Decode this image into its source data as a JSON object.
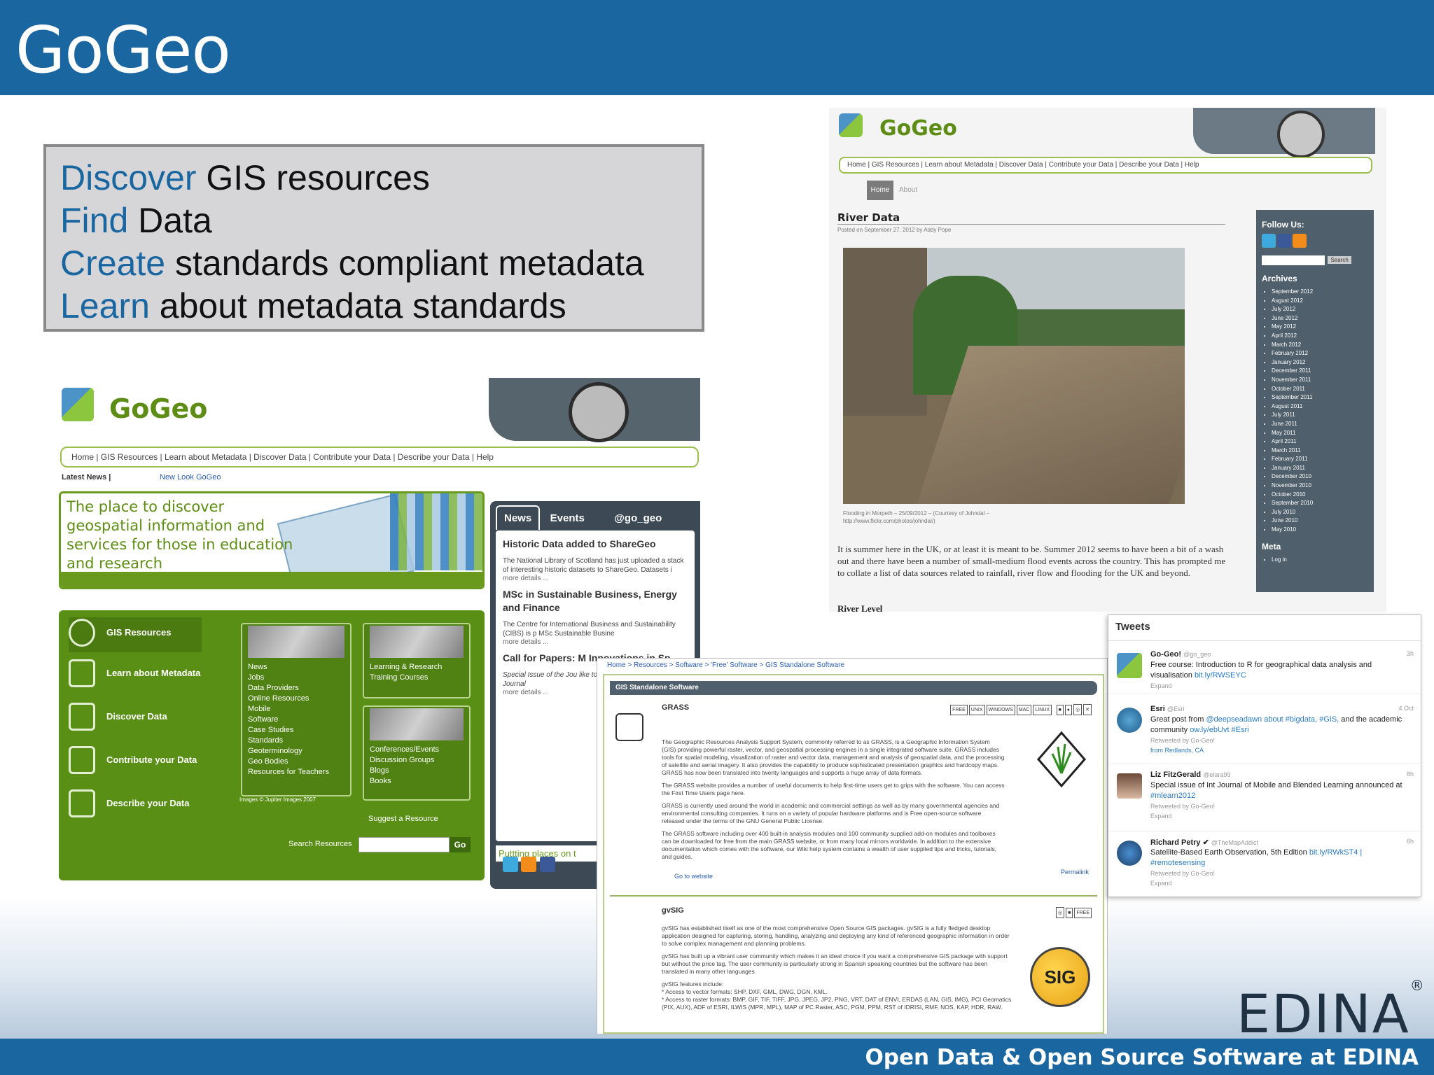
{
  "slide": {
    "title": "GoGeo",
    "footer": "Open Data & Open Source Software at EDINA",
    "logo": "EDINA"
  },
  "callout": [
    {
      "keyword": "Discover",
      "rest": " GIS resources"
    },
    {
      "keyword": "Find",
      "rest": " Data"
    },
    {
      "keyword": "Create",
      "rest": " standards compliant metadata"
    },
    {
      "keyword": "Learn",
      "rest": " about metadata standards"
    }
  ],
  "colors": {
    "brand_blue": "#1a66a0",
    "gogeo_green": "#5a8f16",
    "sidebar_grey": "#4f5f6b",
    "accent_orange": "#e56b1f"
  },
  "blog": {
    "logo": "GoGeo",
    "nav": "Home | GIS Resources | Learn about Metadata | Discover Data | Contribute your Data | Describe your Data | Help",
    "tab_home": "Home",
    "tab_about": "About",
    "post_title": "River Data",
    "posted": "Posted on September 27, 2012 by Addy Pope",
    "caption": "Flooding in Morpeth – 25/09/2012 – (Courtesy of Johndal – http://www.flickr.com/photos/johndal/)",
    "body": "It is summer here in the UK, or at least it is meant to be. Summer 2012 seems to have been a bit of a wash out and there have been a number of small-medium flood events across the country. This has prompted me to collate a list of data sources related to rainfall, river flow and flooding for the UK and beyond.",
    "river_level": "River Level",
    "sidebar": {
      "follow": "Follow Us:",
      "search_btn": "Search",
      "archives": "Archives",
      "months": [
        "September 2012",
        "August 2012",
        "July 2012",
        "June 2012",
        "May 2012",
        "April 2012",
        "March 2012",
        "February 2012",
        "January 2012",
        "December 2011",
        "November 2011",
        "October 2011",
        "September 2011",
        "August 2011",
        "July 2011",
        "June 2011",
        "May 2011",
        "April 2011",
        "March 2011",
        "February 2011",
        "January 2011",
        "December 2010",
        "November 2010",
        "October 2010",
        "September 2010",
        "July 2010",
        "June 2010",
        "May 2010"
      ],
      "meta": "Meta",
      "login": "Log in"
    }
  },
  "portal": {
    "logo": "GoGeo",
    "nav": "Home | GIS Resources | Learn about Metadata | Discover Data | Contribute your Data | Describe your Data | Help",
    "latest": "Latest News |",
    "latest_link": "New Look GoGeo",
    "hero": "The place to discover geospatial information and services for those in education and research",
    "menu": [
      "GIS Resources",
      "Learn about Metadata",
      "Discover Data",
      "Contribute your Data",
      "Describe your Data"
    ],
    "col1": [
      "News",
      "Jobs",
      "Data Providers",
      "Online Resources",
      "Mobile",
      "Software",
      "Case Studies",
      "Standards",
      "Geoterminology",
      "Geo Bodies",
      "Resources for Teachers"
    ],
    "col2a": [
      "Learning & Research",
      "Training Courses"
    ],
    "col2b": [
      "Conferences/Events",
      "Discussion Groups",
      "Blogs",
      "Books"
    ],
    "credit": "Images © Jupiter Images 2007",
    "suggest": "Suggest a Resource",
    "search_label": "Search Resources",
    "go": "Go",
    "tabs": [
      "News",
      "Events",
      "@go_geo"
    ],
    "news": [
      {
        "title": "Historic Data added to ShareGeo",
        "body": "The National Library of Scotland has just uploaded a stack of interesting historic datasets to ShareGeo. Datasets i",
        "more": "more details ..."
      },
      {
        "title": "MSc in Sustainable Business, Energy and Finance",
        "body": "The Centre for International Business and Sustainability (CIBS) is p MSc Sustainable Busine",
        "more": "more details ..."
      },
      {
        "title": "Call for Papers: M Innovations in Sp",
        "body": "Special Issue of the Jou like to invite contribution the Journal",
        "more": "more details ..."
      }
    ],
    "putting": "Puttting places on t"
  },
  "software": {
    "crumb": "Home > Resources > Software > 'Free' Software > GIS Standalone Software",
    "section": "GIS Standalone Software",
    "grass": {
      "name": "GRASS",
      "tags": [
        "FREE",
        "UNIX",
        "WINDOWS",
        "MAC",
        "LINUX"
      ],
      "p1": "The Geographic Resources Analysis Support System, commonly referred to as GRASS, is a Geographic Information System (GIS) providing powerful raster, vector, and geospatial processing engines in a single integrated software suite. GRASS includes tools for spatial modeling, visualization of raster and vector data, management and analysis of geospatial data, and the processing of satellite and aerial imagery. It also provides the capability to produce sophisticated presentation graphics and hardcopy maps. GRASS has now been translated into twenty languages and supports a huge array of data formats.",
      "p2": "The GRASS website provides a number of useful documents to help first-time users get to grips with the software. You can access the First Time Users page here.",
      "p3": "GRASS is currently used around the world in academic and commercial settings as well as by many governmental agencies and environmental consulting companies. It runs on a variety of popular hardware platforms and is Free open-source software released under the terms of the GNU General Public License.",
      "p4": "The GRASS software including over 400 built-in analysis modules and 100 community supplied add-on modules and toolboxes can be downloaded for free from the main GRASS website, or from many local mirrors worldwide. In addition to the extensive documentation which comes with the software, our Wiki help system contains a wealth of user supplied tips and tricks, tutorials, and guides.",
      "goweb": "Go to website",
      "permalink": "Permalink"
    },
    "gvsig": {
      "name": "gvSIG",
      "tags": [
        "FREE"
      ],
      "logo": "SIG",
      "p1": "gvSIG has established itself as one of the most comprehensive Open Source GIS packages. gvSIG is a fully fledged desktop application designed for capturing, storing, handling, analyzing and deploying any kind of referenced geographic information in order to solve complex management and planning problems.",
      "p2": "gvSIG has built up a vibrant user community which makes it an ideal choice if you want a comprehensive GIS package with support but without the price tag. The user community is particularly strong in Spanish speaking countries but the software has been translated in many other languages.",
      "p3": "gvSIG features include:",
      "p4": "* Access to vector formats: SHP, DXF, GML, DWG, DGN, KML.",
      "p5": "* Access to raster formats: BMP, GIF, TIF, TIFF, JPG, JPEG, JP2, PNG, VRT, DAT of ENVI, ERDAS (LAN, GIS, IMG), PCI Geomatics (PIX, AUX), ADF of ESRI, ILWIS (MPR, MPL), MAP of PC Raster, ASC, PGM, PPM, RST of IDRISI, RMF, NOS, KAP, HDR, RAW."
    }
  },
  "tweets": {
    "title": "Tweets",
    "items": [
      {
        "name": "Go-Geo!",
        "handle": "@go_geo",
        "time": "3h",
        "text": "Free course: Introduction to R for geographical data analysis and visualisation",
        "link": "bit.ly/RWSEYC",
        "expand": "Expand"
      },
      {
        "name": "Esri",
        "handle": "@Esri",
        "time": "4 Oct",
        "text": "Great post from",
        "link": "@deepseadawn about #bigdata, #GIS,",
        "text2": "and the academic community",
        "link2": "ow.ly/ebUvt #Esri",
        "retweet": "Retweeted by Go-Geo!",
        "loc": "from Redlands, CA"
      },
      {
        "name": "Liz FitzGerald",
        "handle": "@elara99",
        "time": "8h",
        "text": "Special issue of Int Journal of Mobile and Blended Learning announced at",
        "link": "#mlearn2012",
        "retweet": "Retweeted by Go-Geo!",
        "expand": "Expand"
      },
      {
        "name": "Richard Petry ✔",
        "handle": "@TheMapAddict",
        "time": "6h",
        "text": "Satellite-Based Earth Observation, 5th Edition",
        "link": "bit.ly/RWkST4 | #remotesensing",
        "retweet": "Retweeted by Go-Geo!",
        "expand": "Expand"
      }
    ]
  }
}
